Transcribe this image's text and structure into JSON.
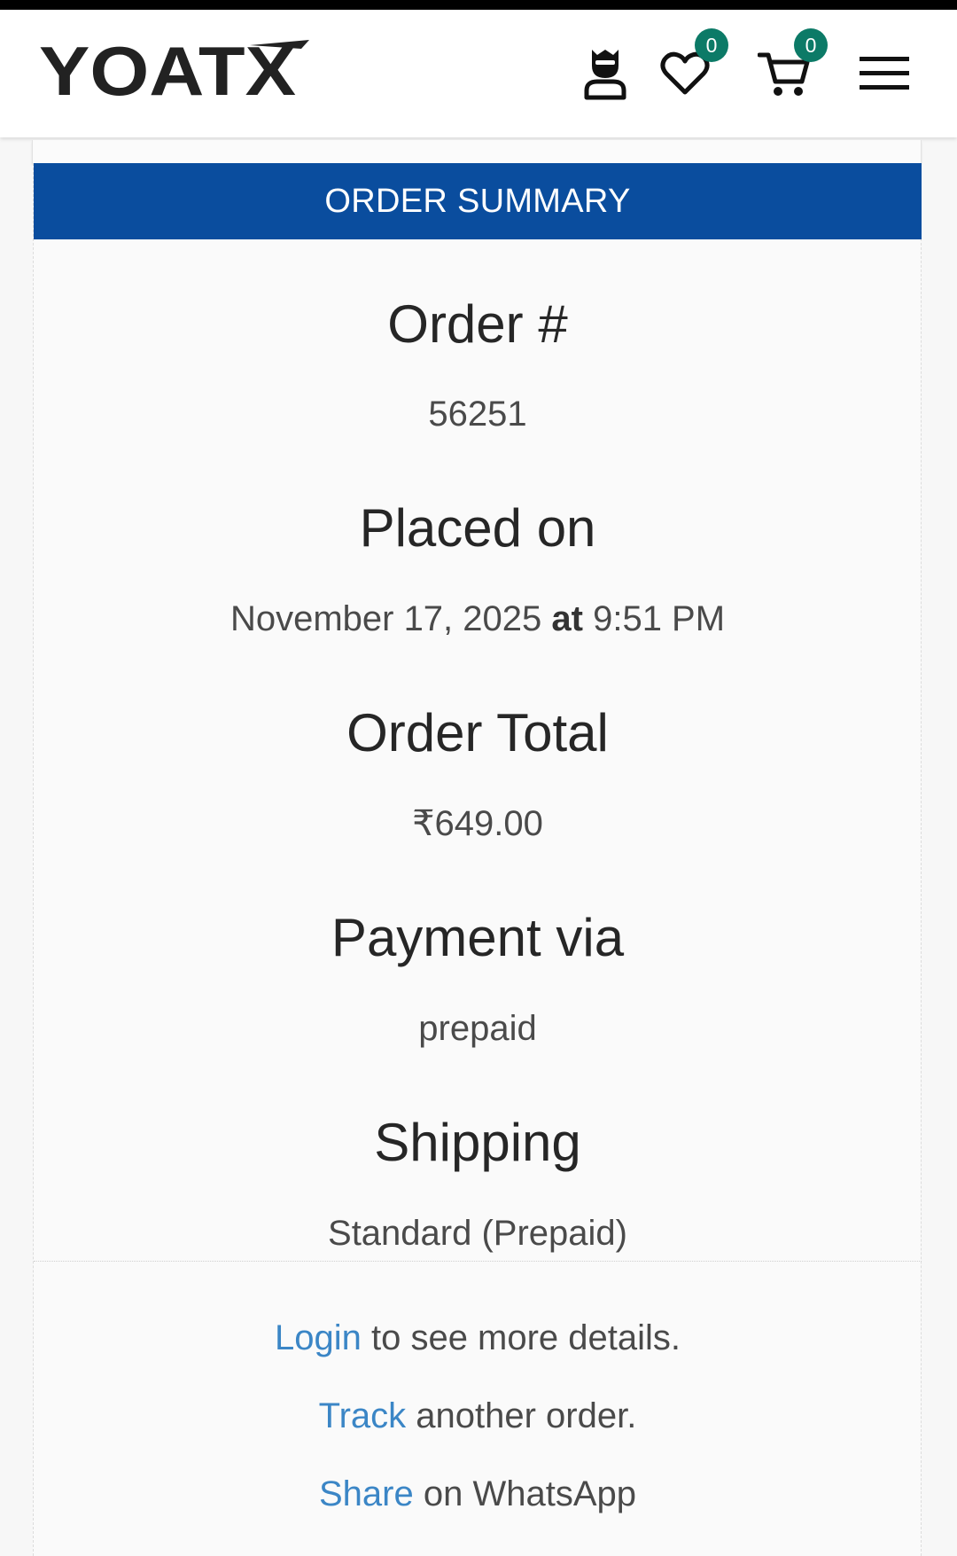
{
  "header": {
    "logo_text": "YOATX",
    "wishlist_count": "0",
    "cart_count": "0",
    "badge_color": "#0c7a67",
    "icons": [
      "user-icon",
      "heart-icon",
      "cart-icon",
      "menu-icon"
    ]
  },
  "summary": {
    "title": "ORDER SUMMARY",
    "title_bg": "#0a4d9e",
    "order_label": "Order #",
    "order_number": "56251",
    "placed_label": "Placed on",
    "placed_date": "November 17, 2025",
    "placed_at_word": "at",
    "placed_time": "9:51 PM",
    "total_label": "Order Total",
    "total_value": "₹649.00",
    "payment_label": "Payment via",
    "payment_value": "prepaid",
    "shipping_label": "Shipping",
    "shipping_value": "Standard (Prepaid)"
  },
  "links": {
    "login_link": "Login",
    "login_rest": "to see more details.",
    "track_link": "Track",
    "track_rest": "another order.",
    "share_link": "Share",
    "share_rest": "on WhatsApp",
    "link_color": "#3b86c6"
  }
}
